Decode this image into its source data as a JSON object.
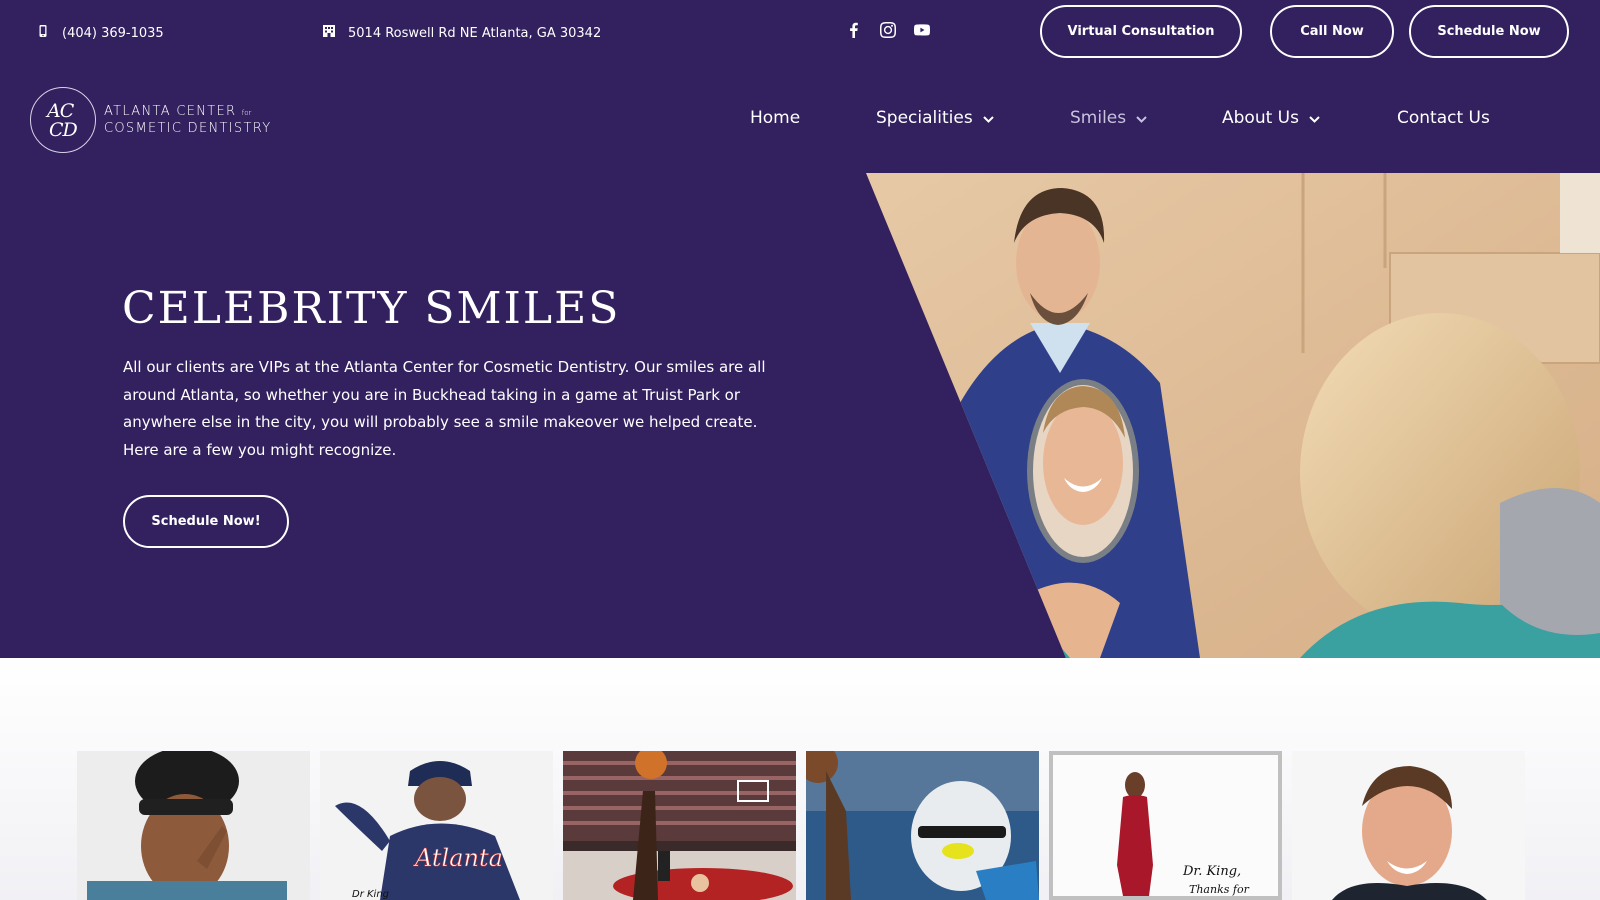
{
  "topbar": {
    "phone": "(404) 369-1035",
    "address": "5014 Roswell Rd NE Atlanta, GA 30342",
    "social_icons": [
      "facebook-icon",
      "instagram-icon",
      "youtube-icon"
    ],
    "buttons": {
      "virtual": "Virtual Consultation",
      "call": "Call Now",
      "schedule": "Schedule Now"
    }
  },
  "logo": {
    "mono_line1": "AC",
    "mono_line2": "CD",
    "name_line1": "ATLANTA CENTER",
    "name_line1_suffix": "for",
    "name_line2": "COSMETIC DENTISTRY"
  },
  "nav": {
    "items": [
      {
        "label": "Home",
        "dropdown": false,
        "active": false
      },
      {
        "label": "Specialities",
        "dropdown": true,
        "active": false
      },
      {
        "label": "Smiles",
        "dropdown": true,
        "active": true
      },
      {
        "label": "About Us",
        "dropdown": true,
        "active": false
      },
      {
        "label": "Contact Us",
        "dropdown": false,
        "active": false
      }
    ]
  },
  "hero": {
    "title": "CELEBRITY SMILES",
    "body": "All our clients are VIPs at the Atlanta Center for Cosmetic Dentistry. Our smiles are all around Atlanta, so whether you are in Buckhead taking in a game at Truist Park or anywhere else in the city, you will probably see a smile makeover we helped create. Here are a few you might recognize.",
    "button": "Schedule Now!"
  },
  "gallery": {
    "cards": [
      {
        "subject": "man-with-headband"
      },
      {
        "subject": "atlanta-baseball-pitcher",
        "signature": "Dr King"
      },
      {
        "subject": "basketball-player"
      },
      {
        "subject": "football-player-helmet"
      },
      {
        "subject": "woman-in-red-dress",
        "signature": "Dr King, Thanks for"
      },
      {
        "subject": "smiling-man-suit"
      }
    ]
  },
  "colors": {
    "brand_purple": "#33205f",
    "white": "#ffffff"
  }
}
